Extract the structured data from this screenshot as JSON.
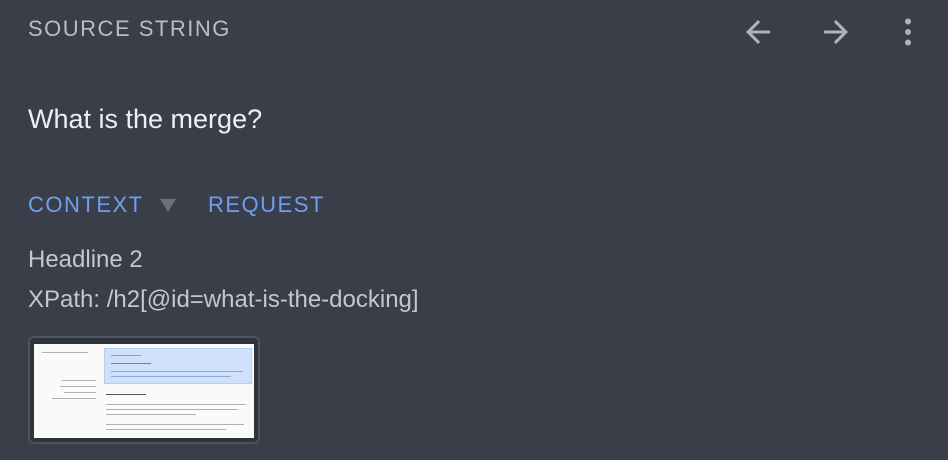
{
  "header": {
    "title": "SOURCE STRING"
  },
  "icons": {
    "back": "arrow-left-icon",
    "forward": "arrow-right-icon",
    "more": "more-vertical-icon"
  },
  "source": {
    "text": "What is the merge?"
  },
  "tabs": {
    "context_label": "CONTEXT",
    "request_label": "REQUEST"
  },
  "context": {
    "element_type": "Headline 2",
    "xpath": "XPath: /h2[@id=what-is-the-docking]"
  },
  "colors": {
    "background": "#393e48",
    "accent": "#6f9ff0",
    "muted_text": "#b9bdc5"
  }
}
